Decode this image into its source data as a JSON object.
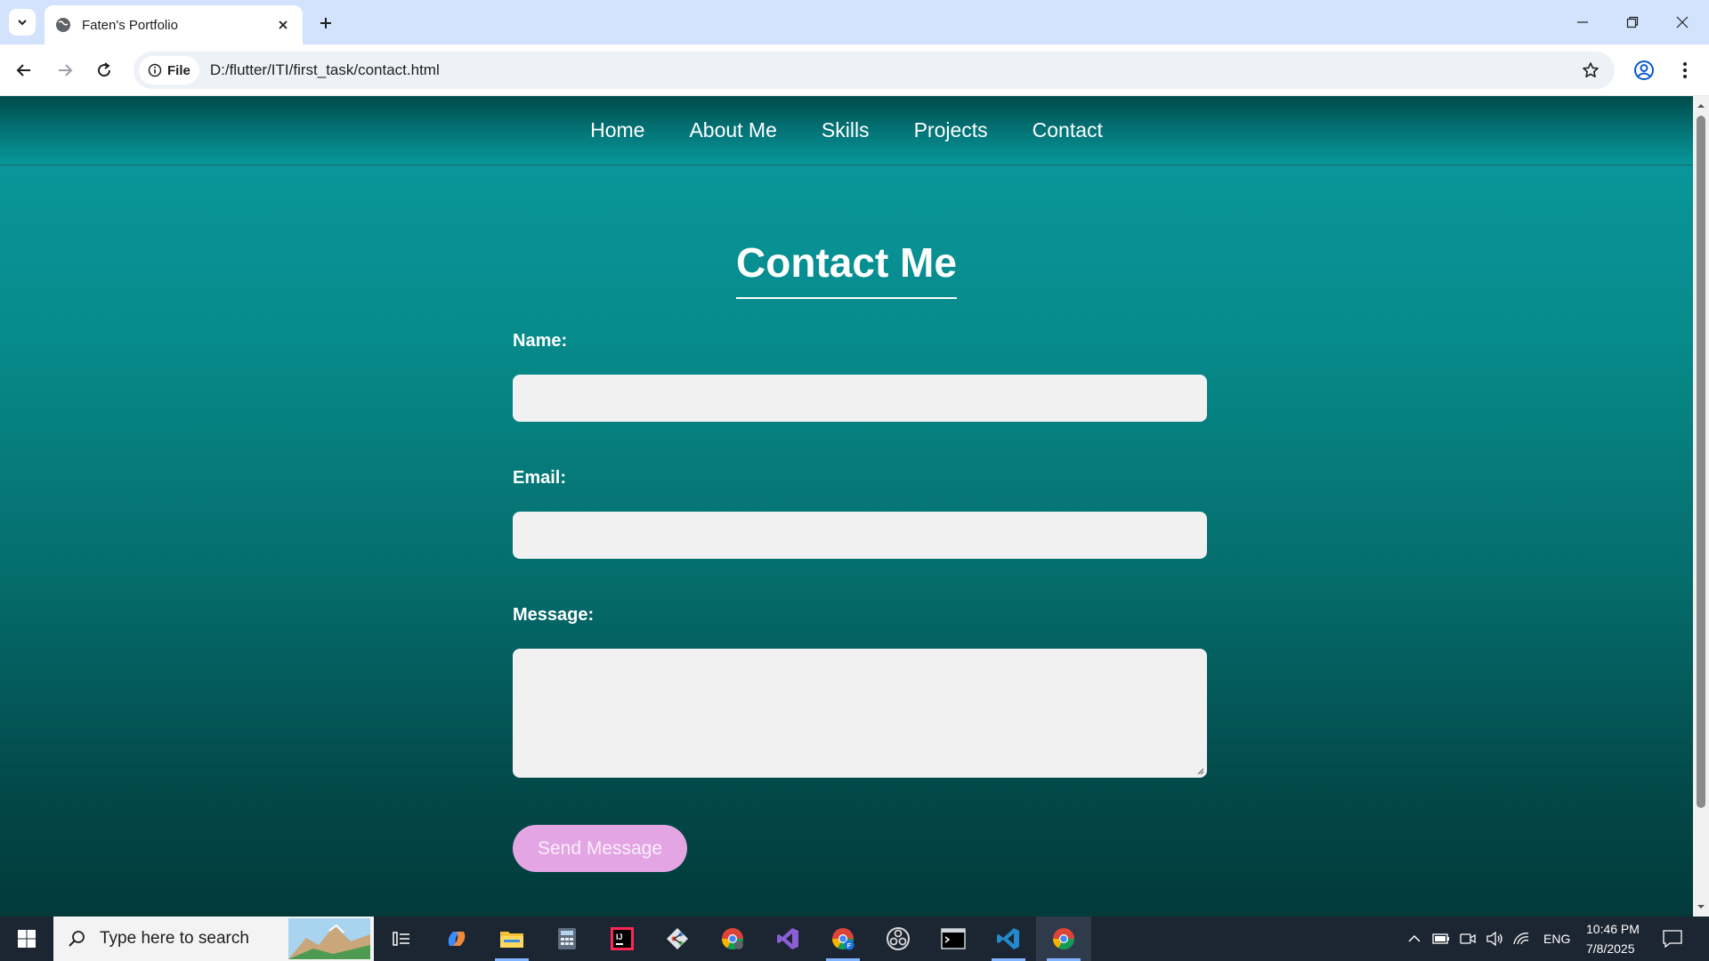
{
  "browser": {
    "tab_title": "Faten's Portfolio",
    "url_chip": "File",
    "url": "D:/flutter/ITI/first_task/contact.html"
  },
  "site": {
    "nav": [
      "Home",
      "About Me",
      "Skills",
      "Projects",
      "Contact"
    ],
    "heading": "Contact Me",
    "name_label": "Name:",
    "email_label": "Email:",
    "message_label": "Message:",
    "send_label": "Send Message"
  },
  "taskbar": {
    "search_placeholder": "Type here to search",
    "language": "ENG",
    "time": "10:46 PM",
    "date": "7/8/2025",
    "apps": [
      "copilot-icon",
      "file-explorer-icon",
      "calculator-icon",
      "intellij-icon",
      "git-icon",
      "chrome-canary-icon",
      "visual-studio-icon",
      "chrome-profile-icon",
      "obs-icon",
      "terminal-icon",
      "vscode-icon",
      "chrome-icon"
    ]
  },
  "colors": {
    "accent_button": "#e3a5e4",
    "page_gradient_top": "#0a9aa0",
    "page_gradient_bottom": "#023a3a"
  }
}
